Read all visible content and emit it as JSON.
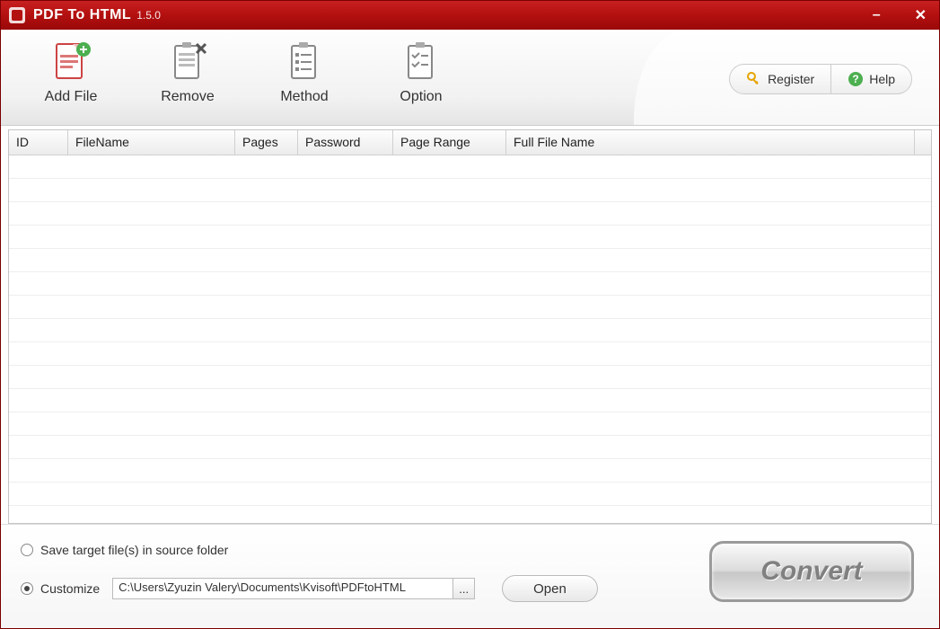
{
  "title": {
    "main": "PDF To HTML",
    "version": "1.5.0"
  },
  "toolbar": {
    "add_file": "Add File",
    "remove": "Remove",
    "method": "Method",
    "option": "Option",
    "register": "Register",
    "help": "Help"
  },
  "table": {
    "headers": {
      "id": "ID",
      "filename": "FileName",
      "pages": "Pages",
      "password": "Password",
      "pagerange": "Page Range",
      "fullfilename": "Full File Name"
    }
  },
  "bottom": {
    "save_source": "Save target file(s) in source folder",
    "customize": "Customize",
    "path": "C:\\Users\\Zyuzin Valery\\Documents\\Kvisoft\\PDFtoHTML",
    "browse": "...",
    "open": "Open",
    "convert": "Convert"
  }
}
